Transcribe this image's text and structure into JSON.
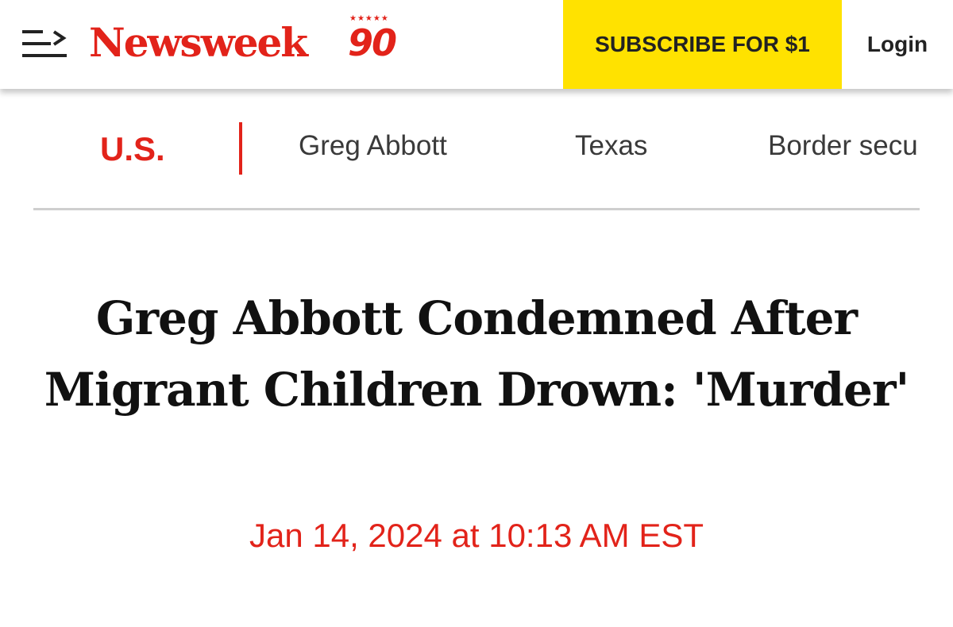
{
  "header": {
    "logo_text": "Newsweek",
    "anniversary_number": "90",
    "anniversary_stars": "★★★★★",
    "subscribe_label": "SUBSCRIBE FOR $1",
    "login_label": "Login",
    "menu_icon": "hamburger-arrow-icon"
  },
  "subnav": {
    "section": "U.S.",
    "tags": [
      "Greg Abbott",
      "Texas",
      "Border security"
    ]
  },
  "article": {
    "headline": "Greg Abbott Condemned After Migrant Children Drown: 'Murder'",
    "timestamp": "Jan 14, 2024 at 10:13 AM EST"
  },
  "colors": {
    "brand_red": "#e2231a",
    "subscribe_yellow": "#ffe200",
    "text_dark": "#111111",
    "tag_gray": "#3a3a3a",
    "divider_gray": "#cfcfcf"
  }
}
